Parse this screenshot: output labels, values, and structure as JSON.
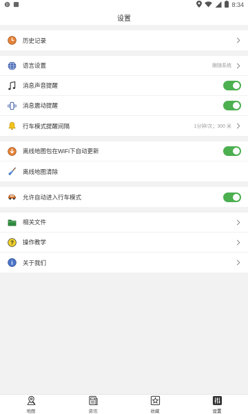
{
  "status_bar": {
    "time": "8:34"
  },
  "header": {
    "title": "设置"
  },
  "groups": [
    [
      {
        "label": "历史记录",
        "icon": "clock-icon",
        "control": "chevron"
      }
    ],
    [
      {
        "label": "语言设置",
        "icon": "globe-icon",
        "control": "chevron",
        "value": "跟随系统"
      },
      {
        "label": "消息声音提醒",
        "icon": "music-note-icon",
        "control": "toggle",
        "on": true
      },
      {
        "label": "消息震动提醒",
        "icon": "vibrate-icon",
        "control": "toggle",
        "on": true
      },
      {
        "label": "行车模式提醒间隔",
        "icon": "bell-icon",
        "control": "chevron",
        "value": "1分钟/次；300 米"
      }
    ],
    [
      {
        "label": "离线地图包在WiFi下自动更新",
        "icon": "download-icon",
        "control": "toggle",
        "on": true
      },
      {
        "label": "离线地图清除",
        "icon": "broom-icon",
        "control": "none"
      }
    ],
    [
      {
        "label": "允许自动进入行车模式",
        "icon": "car-icon",
        "control": "toggle",
        "on": true
      }
    ],
    [
      {
        "label": "相关文件",
        "icon": "folder-icon",
        "control": "chevron"
      },
      {
        "label": "操作教学",
        "icon": "question-icon",
        "control": "chevron"
      },
      {
        "label": "关于我们",
        "icon": "info-icon",
        "control": "chevron"
      }
    ]
  ],
  "bottom_nav": [
    {
      "label": "地图",
      "icon": "map-pin-icon",
      "active": false
    },
    {
      "label": "资讯",
      "icon": "news-icon",
      "active": false
    },
    {
      "label": "收藏",
      "icon": "star-box-icon",
      "active": false
    },
    {
      "label": "设置",
      "icon": "settings-sliders-icon",
      "active": true
    }
  ],
  "colors": {
    "accent": "#4caf50",
    "background": "#f2f2f2"
  }
}
